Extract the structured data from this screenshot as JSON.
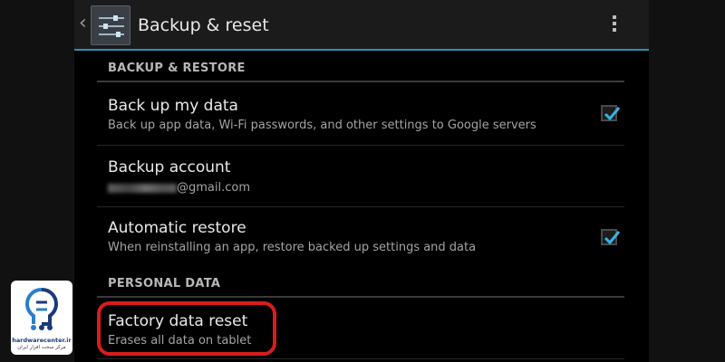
{
  "header": {
    "title": "Backup & reset",
    "up_icon": "chevron-left-icon",
    "app_icon": "settings-sliders-icon",
    "overflow_icon": "overflow-menu-icon"
  },
  "sections": {
    "backup_restore": "BACKUP & RESTORE",
    "personal_data": "PERSONAL DATA"
  },
  "items": {
    "backup_data": {
      "title": "Back up my data",
      "subtitle": "Back up app data, Wi-Fi passwords, and other settings to Google servers",
      "checked": true
    },
    "backup_account": {
      "title": "Backup account",
      "email_suffix": "@gmail.com"
    },
    "auto_restore": {
      "title": "Automatic restore",
      "subtitle": "When reinstalling an app, restore backed up settings and data",
      "checked": true
    },
    "factory_reset": {
      "title": "Factory data reset",
      "subtitle": "Erases all data on tablet"
    }
  },
  "watermark": {
    "site": "hardwarecenter.ir",
    "tagline": "مرکز سخت افزار ایران"
  },
  "colors": {
    "accent": "#2a91b6",
    "checkmark": "#33b5e5",
    "highlight": "#d81d1d"
  }
}
